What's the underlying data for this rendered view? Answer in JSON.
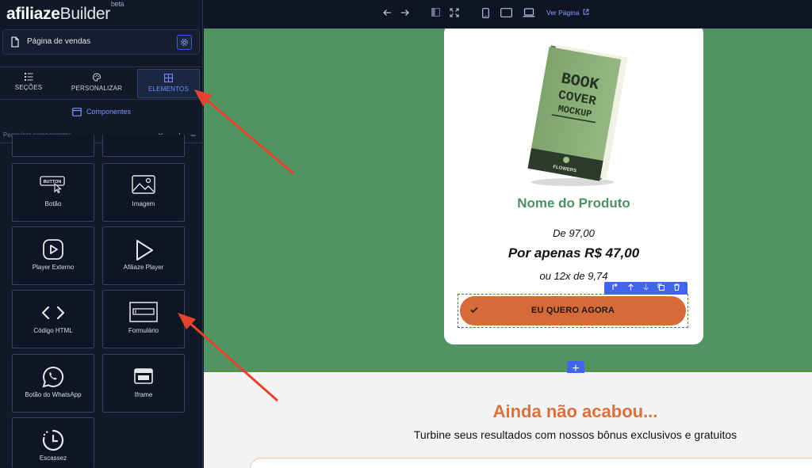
{
  "app": {
    "logo_bold": "afiliaze",
    "logo_light": "Builder",
    "logo_badge": "beta"
  },
  "page": {
    "name": "Página de vendas"
  },
  "tabs": [
    {
      "label": "SEÇÕES",
      "icon": "list-icon"
    },
    {
      "label": "PERSONALIZAR",
      "icon": "palette-icon"
    },
    {
      "label": "ELEMENTOS",
      "icon": "grid-icon",
      "active": true
    }
  ],
  "components": {
    "title": "Componentes",
    "search_placeholder": "Pesquisar componentes",
    "items": [
      {
        "label": "Botão",
        "icon": "button-cursor-icon"
      },
      {
        "label": "Imagem",
        "icon": "image-icon"
      },
      {
        "label": "Player Externo",
        "icon": "play-circle-icon"
      },
      {
        "label": "Afiliaze Player",
        "icon": "play-triangle-icon"
      },
      {
        "label": "Código HTML",
        "icon": "code-icon"
      },
      {
        "label": "Formulário",
        "icon": "form-icon"
      },
      {
        "label": "Botão do WhatsApp",
        "icon": "whatsapp-icon"
      },
      {
        "label": "Iframe",
        "icon": "iframe-icon"
      },
      {
        "label": "Escassez",
        "icon": "timer-icon"
      }
    ],
    "button_icon_text": "BUTTON"
  },
  "topbar": {
    "view_page_label": "Ver Página"
  },
  "product": {
    "book_lines": [
      "BOOK",
      "COVER",
      "MOCKUP"
    ],
    "book_brand": "FLOWERS",
    "name": "Nome do Produto",
    "price_from": "De 97,00",
    "price_now": "Por apenas R$ 47,00",
    "installments": "ou 12x de 9,74",
    "cta_label": "EU QUERO AGORA"
  },
  "bonus": {
    "title": "Ainda não acabou...",
    "subtitle": "Turbine seus resultados com nossos bônus exclusivos e gratuitos"
  },
  "colors": {
    "green_section": "#519462",
    "cta": "#d66a39",
    "accent": "#4263eb",
    "arrow": "#e5432d"
  }
}
